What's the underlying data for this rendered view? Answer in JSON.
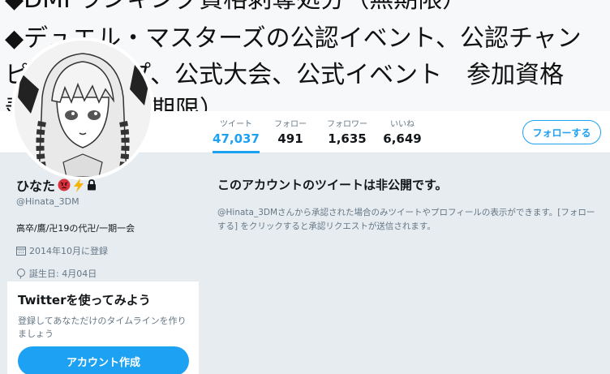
{
  "banner": {
    "lines": [
      "◆DMPランキング資格剥奪処分（無期限）",
      "◆デュエル・マスターズの公認イベント、公認チャン",
      "ピオンシップ、公式大会、公式イベント　参加資格",
      "剥奪処分（無期限）"
    ]
  },
  "nav": {
    "stats": [
      {
        "label": "ツイート",
        "value": "47,037"
      },
      {
        "label": "フォロー",
        "value": "491"
      },
      {
        "label": "フォロワー",
        "value": "1,635"
      },
      {
        "label": "いいね",
        "value": "6,649"
      }
    ],
    "follow_button": "フォローする"
  },
  "profile": {
    "name": "ひなた",
    "handle": "@Hinata_3DM",
    "bio": "高卒/鷹/卍19の代卍/一期一会",
    "joined": "2014年10月に登録",
    "birthday": "誕生日: 4月04日"
  },
  "promo": {
    "title": "Twitterを使ってみよう",
    "text": "登録してあなただけのタイムラインを作りましょう",
    "button": "アカウント作成"
  },
  "notice": {
    "title": "このアカウントのツイートは非公開です。",
    "text": "@Hinata_3DMさんから承認された場合のみツイートやプロフィールの表示ができます。[フォローする] をクリックすると承認リクエストが送信されます。"
  },
  "colors": {
    "accent": "#1da1f2",
    "background": "#e6ecf0",
    "secondary_text": "#657786"
  }
}
